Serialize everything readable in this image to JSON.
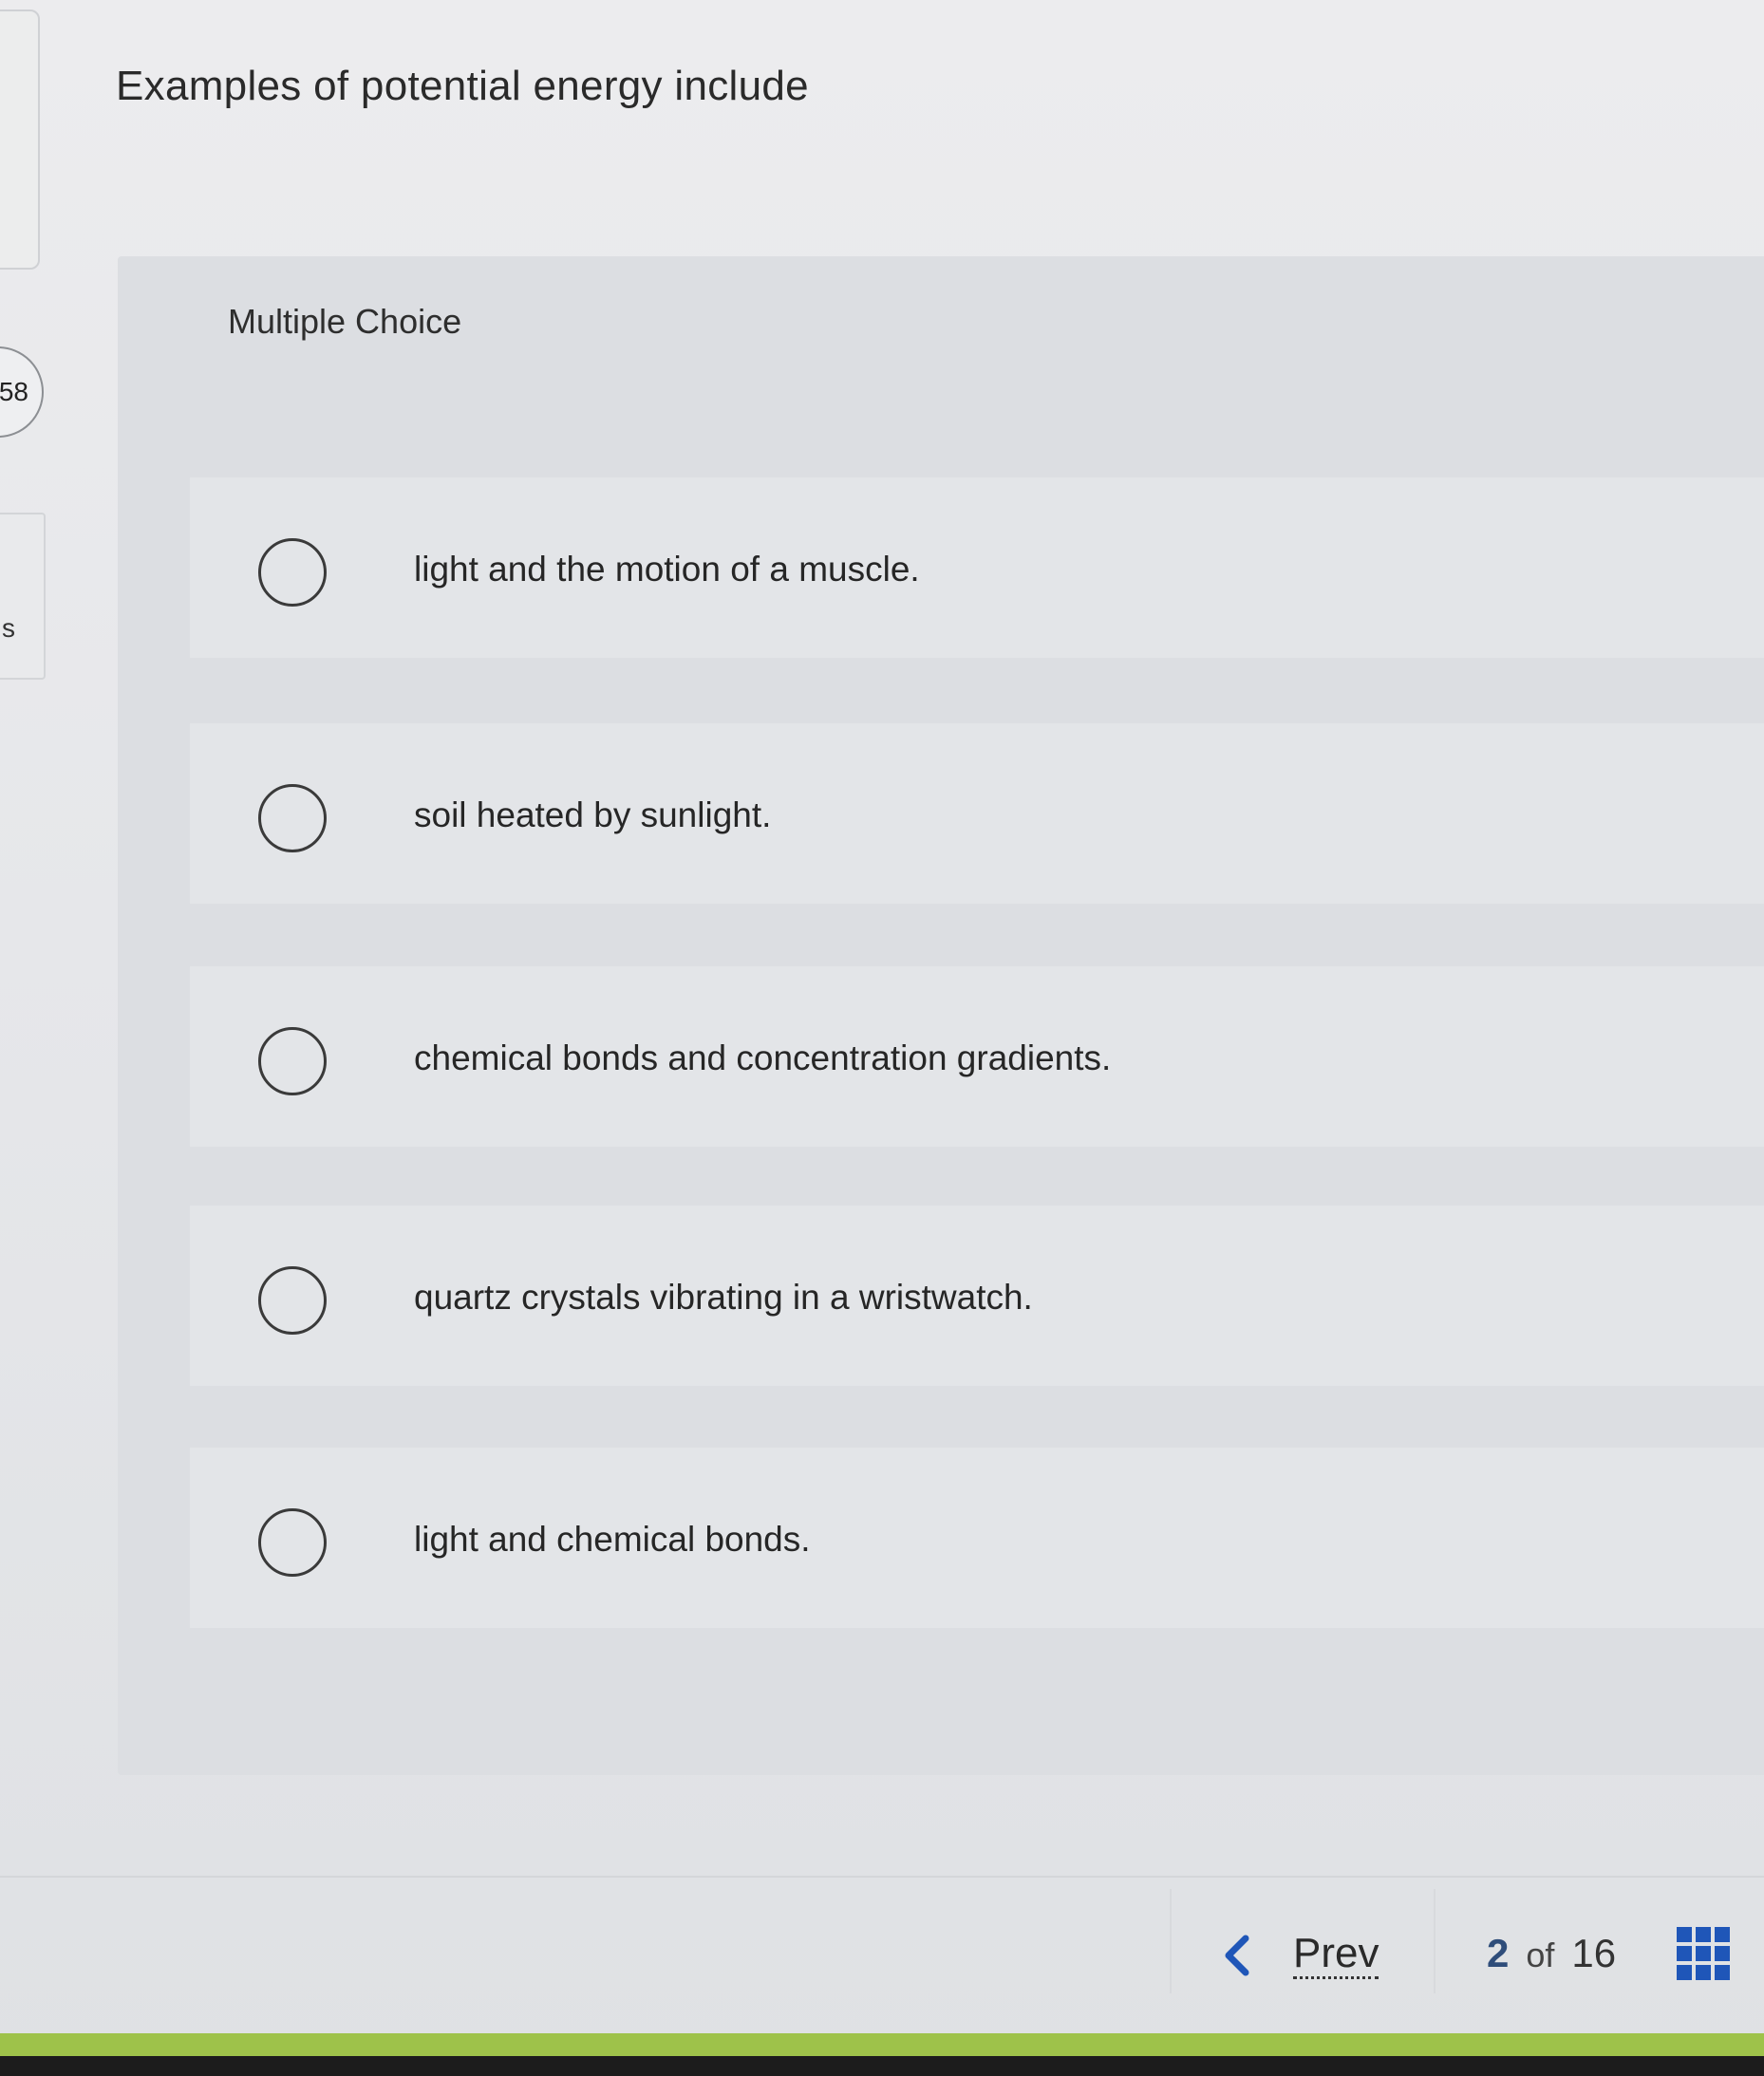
{
  "left_fragments": {
    "badge_text": "58",
    "side_text": "s"
  },
  "question": {
    "text": "Examples of potential energy include"
  },
  "choice_type": "Multiple Choice",
  "options": [
    {
      "label": "light and the motion of a muscle.",
      "selected": false
    },
    {
      "label": "soil heated by sunlight.",
      "selected": false
    },
    {
      "label": "chemical bonds and concentration gradients.",
      "selected": false
    },
    {
      "label": "quartz crystals vibrating in a wristwatch.",
      "selected": false
    },
    {
      "label": "light and chemical bonds.",
      "selected": false
    }
  ],
  "footer": {
    "prev_label": "Prev",
    "current_page": "2",
    "of_label": "of",
    "total_pages": "16"
  },
  "colors": {
    "accent_blue": "#1f56b8",
    "bottom_bar_green": "#9ec24a"
  }
}
